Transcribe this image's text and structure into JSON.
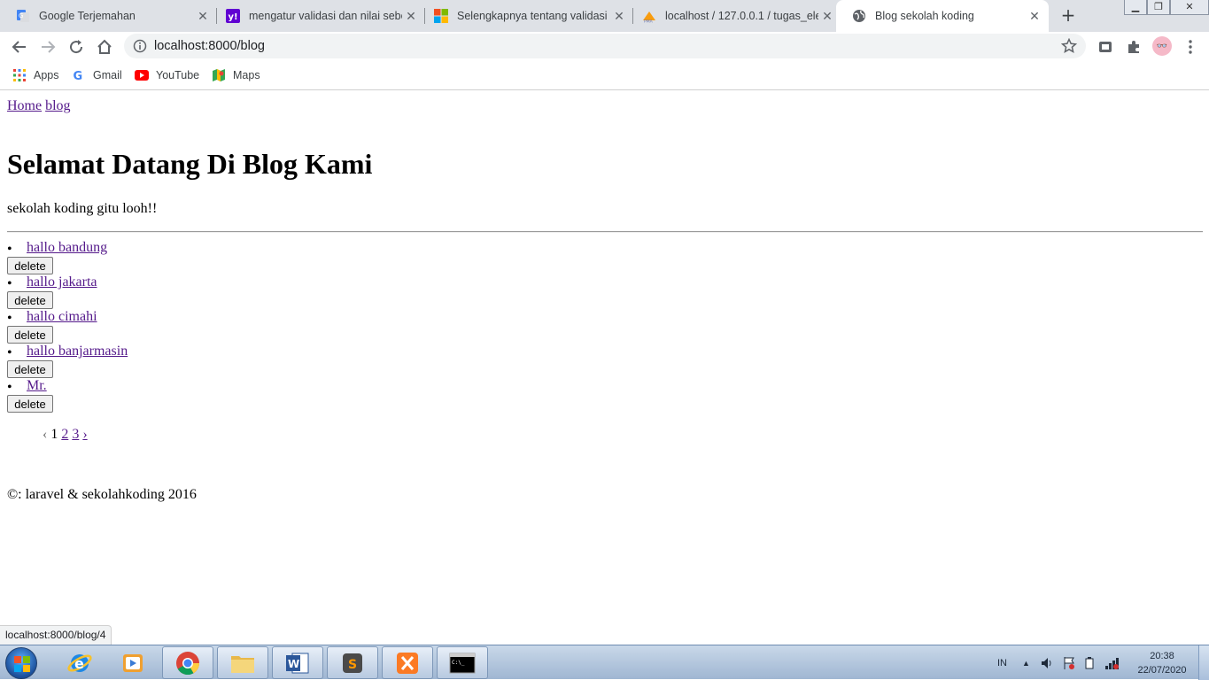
{
  "browser": {
    "tabs": [
      {
        "title": "Google Terjemahan",
        "icon": "google-translate-icon"
      },
      {
        "title": "mengatur validasi dan nilai sebe",
        "icon": "yahoo-icon"
      },
      {
        "title": "Selengkapnya tentang validasi d",
        "icon": "microsoft-icon"
      },
      {
        "title": "localhost / 127.0.0.1 / tugas_ele",
        "icon": "phpmyadmin-icon"
      },
      {
        "title": "Blog sekolah koding",
        "icon": "globe-icon",
        "active": true
      }
    ],
    "url": "localhost:8000/blog",
    "bookmarks": [
      {
        "label": "Apps",
        "icon": "apps-grid-icon"
      },
      {
        "label": "Gmail",
        "icon": "google-g-icon"
      },
      {
        "label": "YouTube",
        "icon": "youtube-icon"
      },
      {
        "label": "Maps",
        "icon": "maps-icon"
      }
    ],
    "status_url": "localhost:8000/blog/4"
  },
  "page": {
    "nav": {
      "home": "Home",
      "blog": "blog"
    },
    "heading": "Selamat Datang Di Blog Kami",
    "tagline": "sekolah koding gitu looh!!",
    "posts": [
      {
        "title": "hallo bandung",
        "delete_label": "delete"
      },
      {
        "title": "hallo jakarta",
        "delete_label": "delete"
      },
      {
        "title": "hallo cimahi",
        "delete_label": "delete"
      },
      {
        "title": "hallo banjarmasin",
        "delete_label": "delete"
      },
      {
        "title": "Mr.",
        "delete_label": "delete"
      }
    ],
    "pagination": {
      "prev": "‹",
      "current": "1",
      "pages": [
        "2",
        "3"
      ],
      "next": "›"
    },
    "footer": "©: laravel & sekolahkoding 2016"
  },
  "taskbar": {
    "language": "IN",
    "time": "20:38",
    "date": "22/07/2020"
  },
  "colors": {
    "link_visited": "#551a8b",
    "tab_strip": "#dee1e6"
  }
}
